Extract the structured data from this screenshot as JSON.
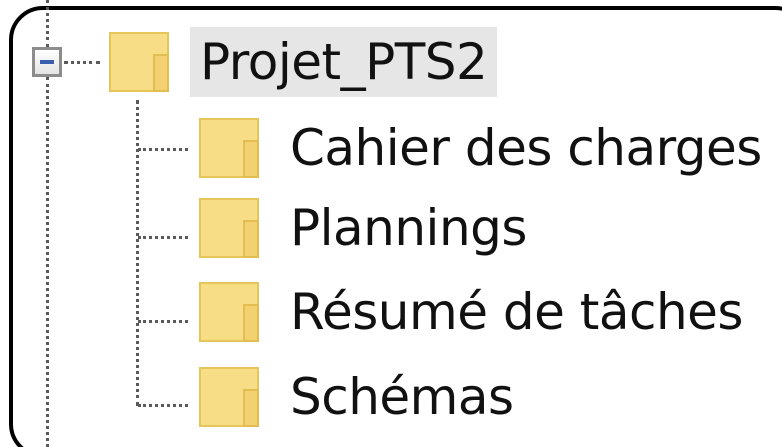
{
  "tree": {
    "root": {
      "label": "Projet_PTS2",
      "expanded": true,
      "expander_icon": "minus-icon",
      "icon": "folder-icon",
      "selected": true
    },
    "children": [
      {
        "label": "Cahier des charges",
        "icon": "folder-icon"
      },
      {
        "label": "Plannings",
        "icon": "folder-icon"
      },
      {
        "label": "Résumé de tâches",
        "icon": "folder-icon"
      },
      {
        "label": "Schémas",
        "icon": "folder-icon"
      }
    ]
  },
  "colors": {
    "folder_fill": "#f7dd86",
    "folder_edge": "#e6c55a",
    "selection_bg": "#e6e6e6",
    "connector": "#5a5a5a",
    "expander_minus": "#3b5fb0"
  }
}
